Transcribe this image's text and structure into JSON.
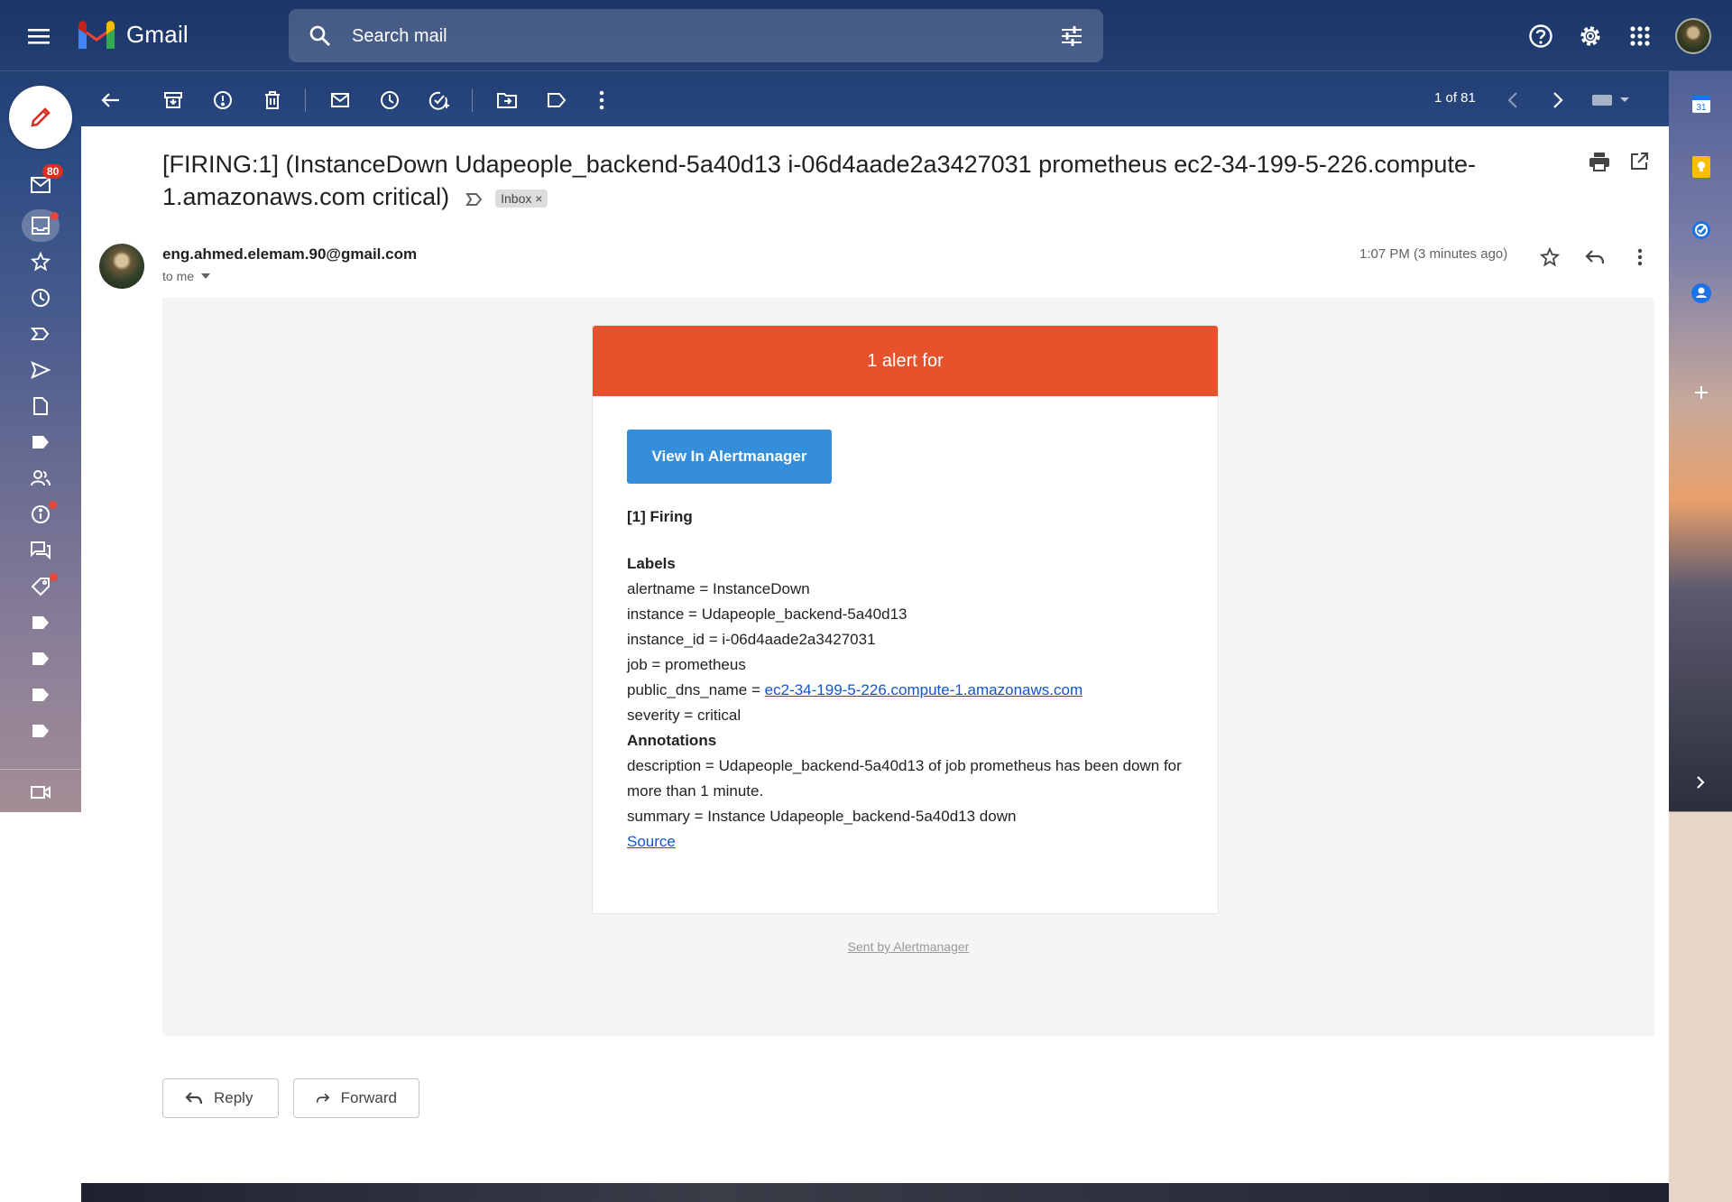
{
  "app": {
    "name": "Gmail"
  },
  "search": {
    "placeholder": "Search mail"
  },
  "rail": {
    "inbox_badge": "80"
  },
  "toolbar": {
    "pager": "1 of 81"
  },
  "email": {
    "subject": "[FIRING:1] (InstanceDown Udapeople_backend-5a40d13 i-06d4aade2a3427031 prometheus ec2-34-199-5-226.compute-1.amazonaws.com critical)",
    "label_chip": "Inbox",
    "label_chip_close": "×",
    "sender": "eng.ahmed.elemam.90@gmail.com",
    "recipient": "to me",
    "time": "1:07 PM (3 minutes ago)"
  },
  "alert": {
    "header": "1 alert for",
    "button": "View In Alertmanager",
    "firing": "[1] Firing",
    "labels_heading": "Labels",
    "labels": [
      "alertname = InstanceDown",
      "instance = Udapeople_backend-5a40d13",
      "instance_id = i-06d4aade2a3427031",
      "job = prometheus"
    ],
    "dns_key": "public_dns_name = ",
    "dns_value": "ec2-34-199-5-226.compute-1.amazonaws.com",
    "severity": "severity = critical",
    "annotations_heading": "Annotations",
    "description": "description = Udapeople_backend-5a40d13 of job prometheus has been down for more than 1 minute.",
    "summary": "summary = Instance Udapeople_backend-5a40d13 down",
    "source_link": "Source",
    "sent_by": "Sent by Alertmanager"
  },
  "actions": {
    "reply": "Reply",
    "forward": "Forward"
  },
  "colors": {
    "alert_red": "#e6522c",
    "button_blue": "#348eda",
    "badge_red": "#d93025"
  }
}
